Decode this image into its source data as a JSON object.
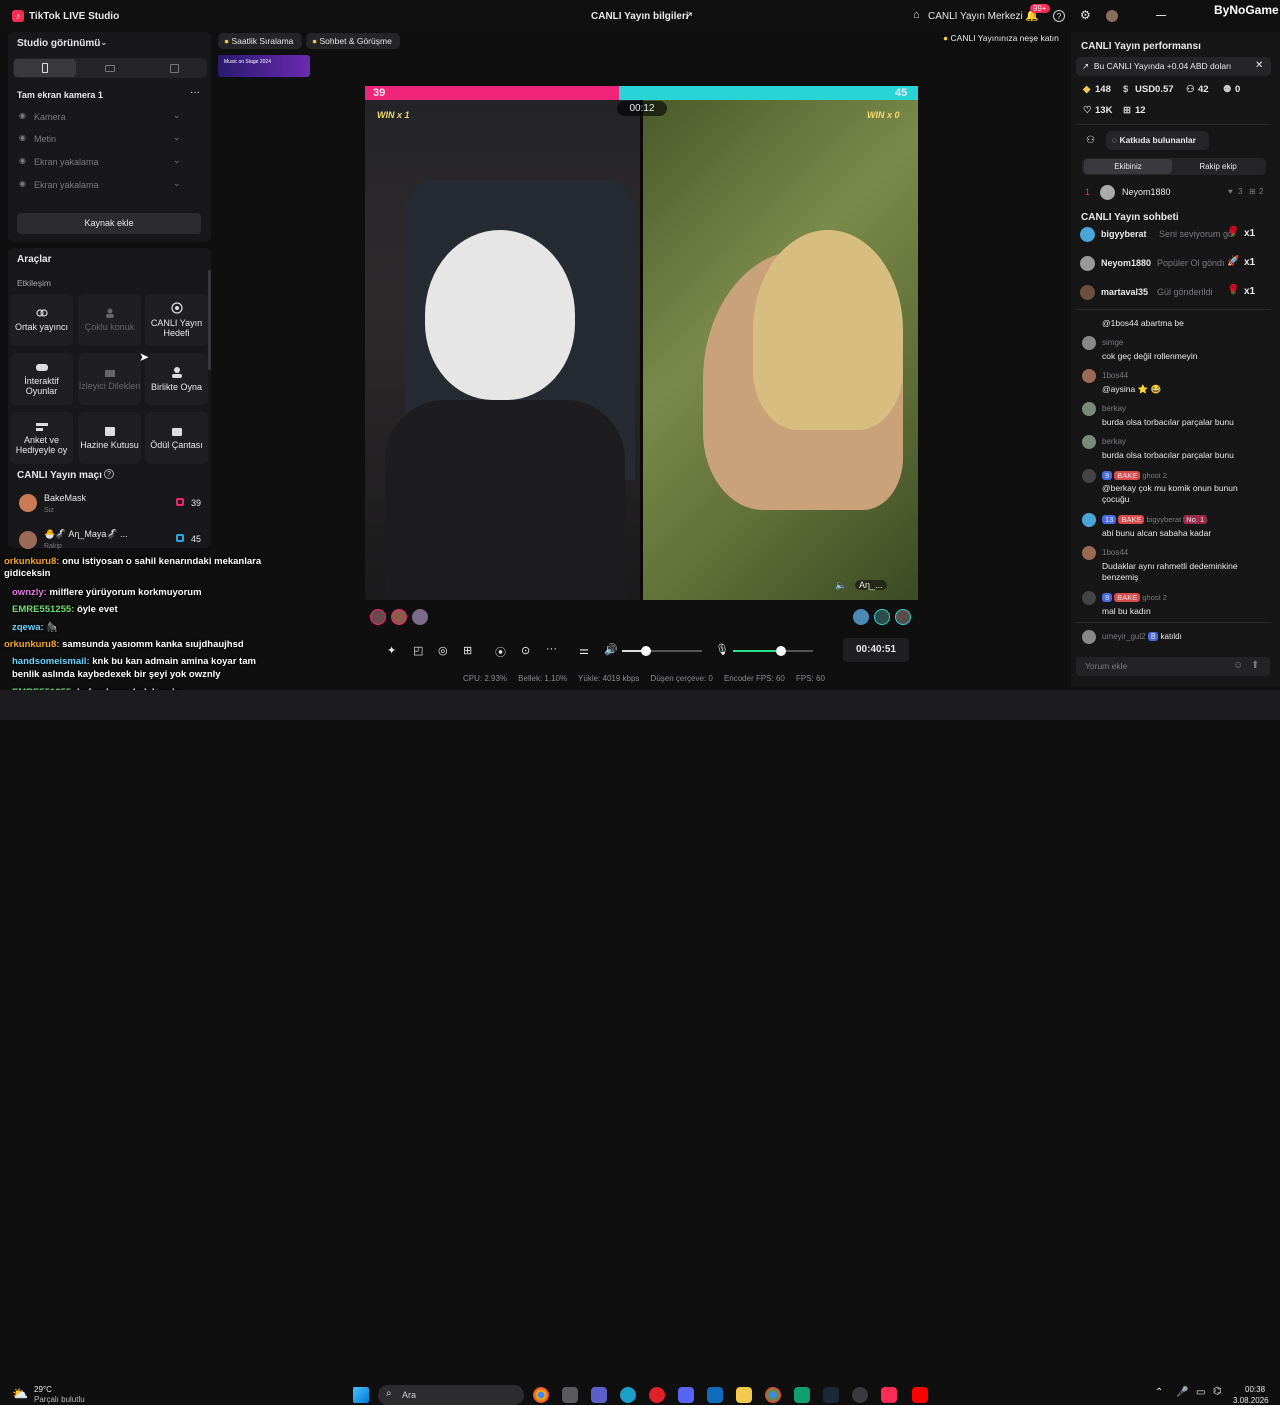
{
  "app": {
    "title": "TikTok LIVE Studio",
    "center": "CANLI Yayın bilgileri",
    "center_btn": "CANLI Yayın Merkezi",
    "notif_badge": "99+",
    "brand": "ByNoGame"
  },
  "studio": {
    "view_label": "Studio görünümü",
    "camera_label": "Tam ekran kamera 1",
    "sources": [
      "Kamera",
      "Metin",
      "Ekran yakalama",
      "Ekran yakalama"
    ],
    "add_source": "Kaynak ekle"
  },
  "tools": {
    "title": "Araçlar",
    "section": "Etkileşim",
    "items": [
      "Ortak yayıncı",
      "Çoklu konuk",
      "CANLI Yayın Hedefi",
      "İnteraktif Oyunlar",
      "İzleyici Dilekleri",
      "Birlikte Oyna",
      "Anket ve Hediyeyle oy",
      "Hazine Kutusu",
      "Ödül Çantası"
    ]
  },
  "match": {
    "title": "CANLI Yayın maçı",
    "p1_name": "BakeMask",
    "p1_role": "Siz",
    "p1_score": "39",
    "p2_name": "🐣🦨 Aη_Maya🦨 ...",
    "p2_role": "Rakip",
    "p2_score": "45"
  },
  "top_chips": {
    "chip1": "Saatlik Sıralama",
    "chip2": "Sohbet & Görüşme",
    "hint": "CANLI Yayınınıza neşe katın",
    "banner": "Music on Stage 2024"
  },
  "battle": {
    "left_score": "39",
    "right_score": "45",
    "timer": "00:12",
    "left_win": "WIN x 1",
    "right_win": "WIN x 0",
    "right_name": "Aη_...",
    "avatars_left": [
      "3",
      "2",
      ""
    ],
    "avatars_right": [
      "",
      "2",
      ""
    ],
    "left_fill": 0.46
  },
  "controls": {
    "duration": "00:40:51",
    "volume": 0.3,
    "mic": 0.6
  },
  "stats": {
    "cpu": "CPU: 2.93%",
    "mem": "Bellek: 1.10%",
    "upload": "Yükle: 4019 kbps",
    "drop": "Düşen çerçeve: 0",
    "enc": "Encoder FPS: 60",
    "fps": "FPS: 60"
  },
  "overlay_chat": [
    {
      "user": "orkunkuru8:",
      "msg": "onu istiyosan o sahil kenarındaki mekanlara gidiceksin"
    },
    {
      "user": "ownzly:",
      "msg": "milflere yürüyorum korkmuyorum"
    },
    {
      "user": "EMRE551255:",
      "msg": "öyle evet"
    },
    {
      "user": "zqewa:",
      "msg": "🦍"
    },
    {
      "user": "orkunkuru8:",
      "msg": "samsunda yasıomm kanka sıujdhaujhsd"
    },
    {
      "user": "handsomeismail:",
      "msg": "knk bu karı admain amina koyar tam benlik aslında kaybedexek bir şeyi yok owznly"
    },
    {
      "user": "EMRE551255:",
      "msg": "bafra dayım knk bende"
    }
  ],
  "perf": {
    "title": "CANLI Yayın performansı",
    "notice": "Bu CANLI Yayında +0.04 ABD doları",
    "coins": "148",
    "usd": "USD0.57",
    "viewers": "42",
    "x": "0",
    "likes": "13K",
    "gifts": "12",
    "contrib_btn": "Katkıda bulunanlar",
    "tab1": "Ekibiniz",
    "tab2": "Rakip ekip",
    "rank": "1",
    "rank_user": "Neyom1880",
    "rank_a": "3",
    "rank_b": "2"
  },
  "chat": {
    "title": "CANLI Yayın sohbeti",
    "gifts": [
      {
        "user": "bigyyberat",
        "msg": "Seni seviyorum gö",
        "count": "x1"
      },
      {
        "user": "Neyom1880",
        "msg": "Popüler Ol göndı",
        "count": "x1"
      },
      {
        "user": "martaval35",
        "msg": "Gül gönderildi",
        "count": "x1"
      }
    ],
    "messages": [
      {
        "user": "",
        "msg": "@1bos44 abartma be"
      },
      {
        "user": "simge",
        "msg": "cok geç değil rollenmeyin"
      },
      {
        "user": "1bos44",
        "msg": "@aysina ⭐ 😂"
      },
      {
        "user": "berkay",
        "msg": "burda olsa torbacılar parçalar bunu"
      },
      {
        "user": "berkay",
        "msg": "burda olsa torbacılar parçalar bunu"
      },
      {
        "user": "ghost 2",
        "msg": "@berkay çok mu komik onun bunun çocuğu",
        "badge": "9",
        "badge2": "BAKE"
      },
      {
        "user": "bigyyberat",
        "msg": "abi bunu alcan sabaha kadar",
        "badge": "13",
        "badge2": "BAKE",
        "badge3": "No. 1"
      },
      {
        "user": "1bos44",
        "msg": "Dudaklar aynı rahmetli dedeminkine benzemiş"
      },
      {
        "user": "ghost 2",
        "msg": "mal bu kadın",
        "badge": "9",
        "badge2": "BAKE"
      }
    ],
    "join_user": "umeyir_gul2",
    "join_badge": "8",
    "join_text": "katıldı",
    "input_placeholder": "Yorum ekle"
  },
  "taskbar": {
    "weather_temp": "29°C",
    "weather_text": "Parçalı bulutlu",
    "search": "Ara",
    "time": "00:38",
    "date": "3.08.2026"
  },
  "colors": {
    "pink": "#f0257a",
    "cyan": "#27d5d6",
    "accent": "#fe2c55"
  }
}
